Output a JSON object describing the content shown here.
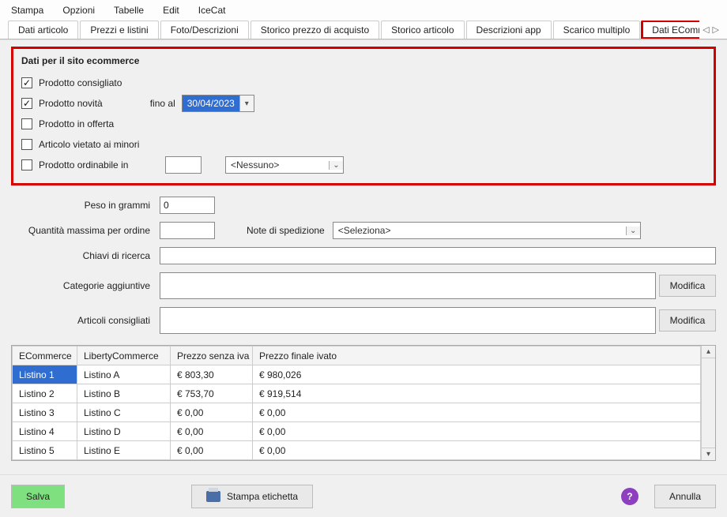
{
  "menubar": [
    "Stampa",
    "Opzioni",
    "Tabelle",
    "Edit",
    "IceCat"
  ],
  "tabs": [
    {
      "label": "Dati articolo",
      "highlight": false
    },
    {
      "label": "Prezzi e listini",
      "highlight": false
    },
    {
      "label": "Foto/Descrizioni",
      "highlight": false
    },
    {
      "label": "Storico prezzo di acquisto",
      "highlight": false
    },
    {
      "label": "Storico articolo",
      "highlight": false
    },
    {
      "label": "Descrizioni app",
      "highlight": false
    },
    {
      "label": "Scarico multiplo",
      "highlight": false
    },
    {
      "label": "Dati ECommerce",
      "highlight": true
    }
  ],
  "ecommerce_box": {
    "title": "Dati per il sito ecommerce",
    "chk_consigliato": {
      "label": "Prodotto consigliato",
      "checked": true
    },
    "chk_novita": {
      "label": "Prodotto novità",
      "checked": true
    },
    "fino_al_label": "fino al",
    "fino_al_value": "30/04/2023",
    "chk_offerta": {
      "label": "Prodotto in offerta",
      "checked": false
    },
    "chk_minori": {
      "label": "Articolo vietato ai minori",
      "checked": false
    },
    "chk_ordinabile": {
      "label": "Prodotto ordinabile in",
      "checked": false
    },
    "ordinabile_unit": "<Nessuno>"
  },
  "fields": {
    "peso_label": "Peso in grammi",
    "peso_value": "0",
    "qta_max_label": "Quantità massima per ordine",
    "qta_max_value": "",
    "note_sped_label": "Note di spedizione",
    "note_sped_value": "<Seleziona>",
    "chiavi_label": "Chiavi di ricerca",
    "categorie_label": "Categorie aggiuntive",
    "articoli_cons_label": "Articoli consigliati",
    "modifica_label": "Modifica"
  },
  "grid": {
    "headers": [
      "ECommerce",
      "LibertyCommerce",
      "Prezzo senza iva",
      "Prezzo finale ivato"
    ],
    "rows": [
      {
        "c0": "Listino 1",
        "c1": "Listino A",
        "c2": "€ 803,30",
        "c3": "€ 980,026",
        "selected": true
      },
      {
        "c0": "Listino 2",
        "c1": "Listino B",
        "c2": "€ 753,70",
        "c3": "€ 919,514",
        "selected": false
      },
      {
        "c0": "Listino 3",
        "c1": "Listino C",
        "c2": "€ 0,00",
        "c3": "€ 0,00",
        "selected": false
      },
      {
        "c0": "Listino 4",
        "c1": "Listino D",
        "c2": "€ 0,00",
        "c3": "€ 0,00",
        "selected": false
      },
      {
        "c0": "Listino 5",
        "c1": "Listino E",
        "c2": "€ 0,00",
        "c3": "€ 0,00",
        "selected": false
      }
    ]
  },
  "footer": {
    "save": "Salva",
    "print": "Stampa etichetta",
    "cancel": "Annulla"
  }
}
